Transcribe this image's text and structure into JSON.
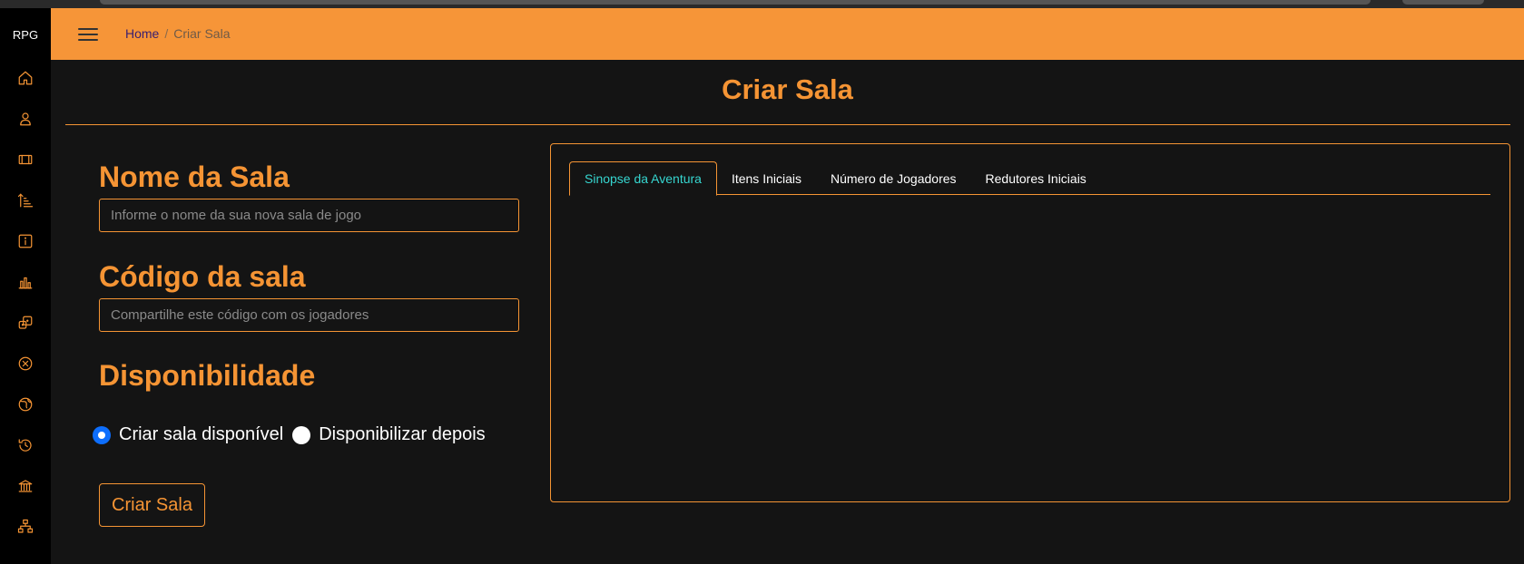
{
  "sidebar": {
    "brand": "RPG",
    "items": [
      {
        "icon": "home-icon"
      },
      {
        "icon": "user-icon"
      },
      {
        "icon": "film-icon"
      },
      {
        "icon": "sort-ascending-icon"
      },
      {
        "icon": "info-square-icon"
      },
      {
        "icon": "bar-chart-icon"
      },
      {
        "icon": "dice-icon"
      },
      {
        "icon": "x-circle-icon"
      },
      {
        "icon": "globe-icon"
      },
      {
        "icon": "history-icon"
      },
      {
        "icon": "bank-icon"
      },
      {
        "icon": "sitemap-icon"
      }
    ]
  },
  "header": {
    "breadcrumb": {
      "home": "Home",
      "separator": "/",
      "current": "Criar Sala"
    }
  },
  "main": {
    "title": "Criar Sala",
    "form": {
      "room_name_label": "Nome da Sala",
      "room_name_placeholder": "Informe o nome da sua nova sala de jogo",
      "room_name_value": "",
      "room_code_label": "Código da sala",
      "room_code_placeholder": "Compartilhe este código com os jogadores",
      "room_code_value": "",
      "availability_label": "Disponibilidade",
      "availability_options": [
        {
          "label": "Criar sala disponível",
          "checked": true
        },
        {
          "label": "Disponibilizar depois",
          "checked": false
        }
      ],
      "submit_label": "Criar Sala"
    },
    "tabs": [
      {
        "label": "Sinopse da Aventura",
        "active": true
      },
      {
        "label": "Itens Iniciais",
        "active": false
      },
      {
        "label": "Número de Jogadores",
        "active": false
      },
      {
        "label": "Redutores Iniciais",
        "active": false
      }
    ]
  },
  "colors": {
    "accent": "#f59434",
    "header": "#f69538",
    "active_tab_text": "#36d6d0",
    "radio_checked": "#0d6efd"
  }
}
